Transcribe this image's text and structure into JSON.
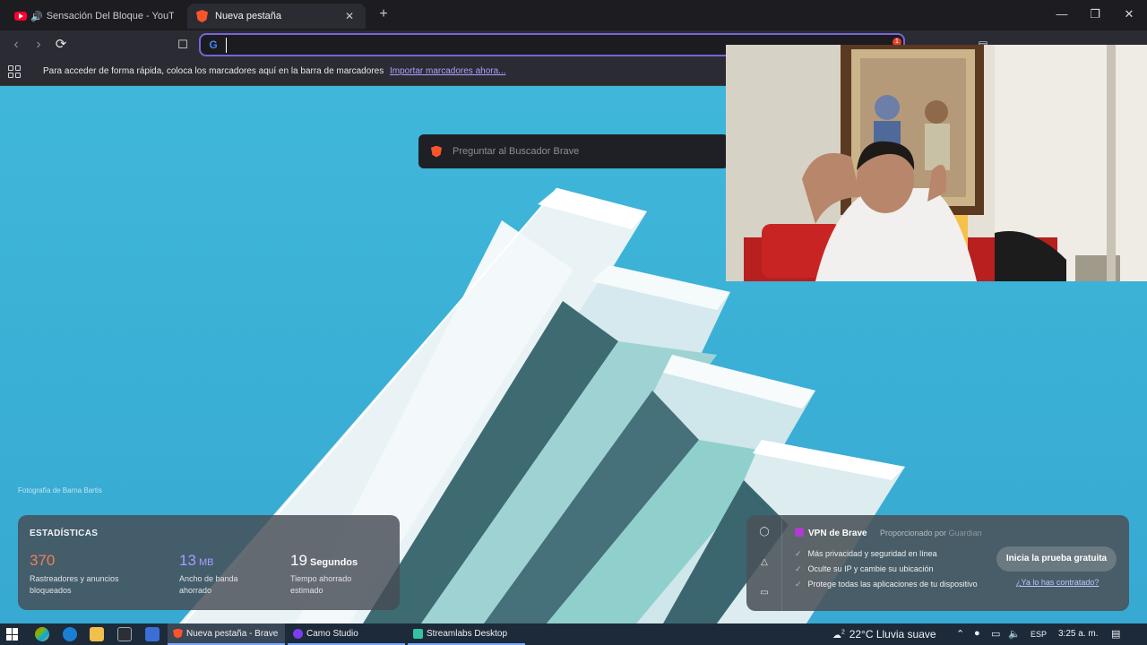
{
  "tabs": [
    {
      "title": "Sensación Del Bloque - YouTube",
      "active": false
    },
    {
      "title": "Nueva pestaña",
      "active": true
    }
  ],
  "toolbar": {
    "address_value": "",
    "shield_badge": "1"
  },
  "bookmarks_bar": {
    "hint": "Para acceder de forma rápida, coloca los marcadores aquí en la barra de marcadores",
    "import_link": "Importar marcadores ahora..."
  },
  "new_tab": {
    "search_placeholder": "Preguntar al Buscador Brave",
    "photo_credit": "Fotografía de Barna Bartis"
  },
  "stats": {
    "title": "ESTADÍSTICAS",
    "items": [
      {
        "number": "370",
        "unit": "",
        "label_line1": "Rastreadores y anuncios",
        "label_line2": "bloqueados",
        "color": "#f27f55"
      },
      {
        "number": "13",
        "unit": " MB",
        "label_line1": "Ancho de banda",
        "label_line2": "ahorrado",
        "color": "#a89cff"
      },
      {
        "number": "19",
        "unit": " Segundos",
        "label_line1": "Tiempo ahorrado",
        "label_line2": "estimado",
        "color": "#ffffff"
      }
    ]
  },
  "vpn": {
    "title": "VPN de Brave",
    "provided_by": "Proporcionado por",
    "provider": "Guardian",
    "features": [
      "Más privacidad y seguridad en línea",
      "Oculte su IP y cambie su ubicación",
      "Protege todas las aplicaciones de tu dispositivo"
    ],
    "cta": "Inicia la prueba gratuita",
    "link": "¿Ya lo has contratado?"
  },
  "taskbar": {
    "apps": [
      {
        "label": "Nueva pestaña - Brave",
        "active": true
      },
      {
        "label": "Camo Studio",
        "active": false
      },
      {
        "label": "Streamlabs Desktop",
        "active": false
      }
    ],
    "weather_badge": "2",
    "weather": "22°C  Lluvia suave",
    "lang": "ESP",
    "time": "3:25 a. m."
  },
  "colors": {
    "accent": "#7466d8",
    "brave": "#fb542b",
    "sky": "#3fb7da"
  }
}
